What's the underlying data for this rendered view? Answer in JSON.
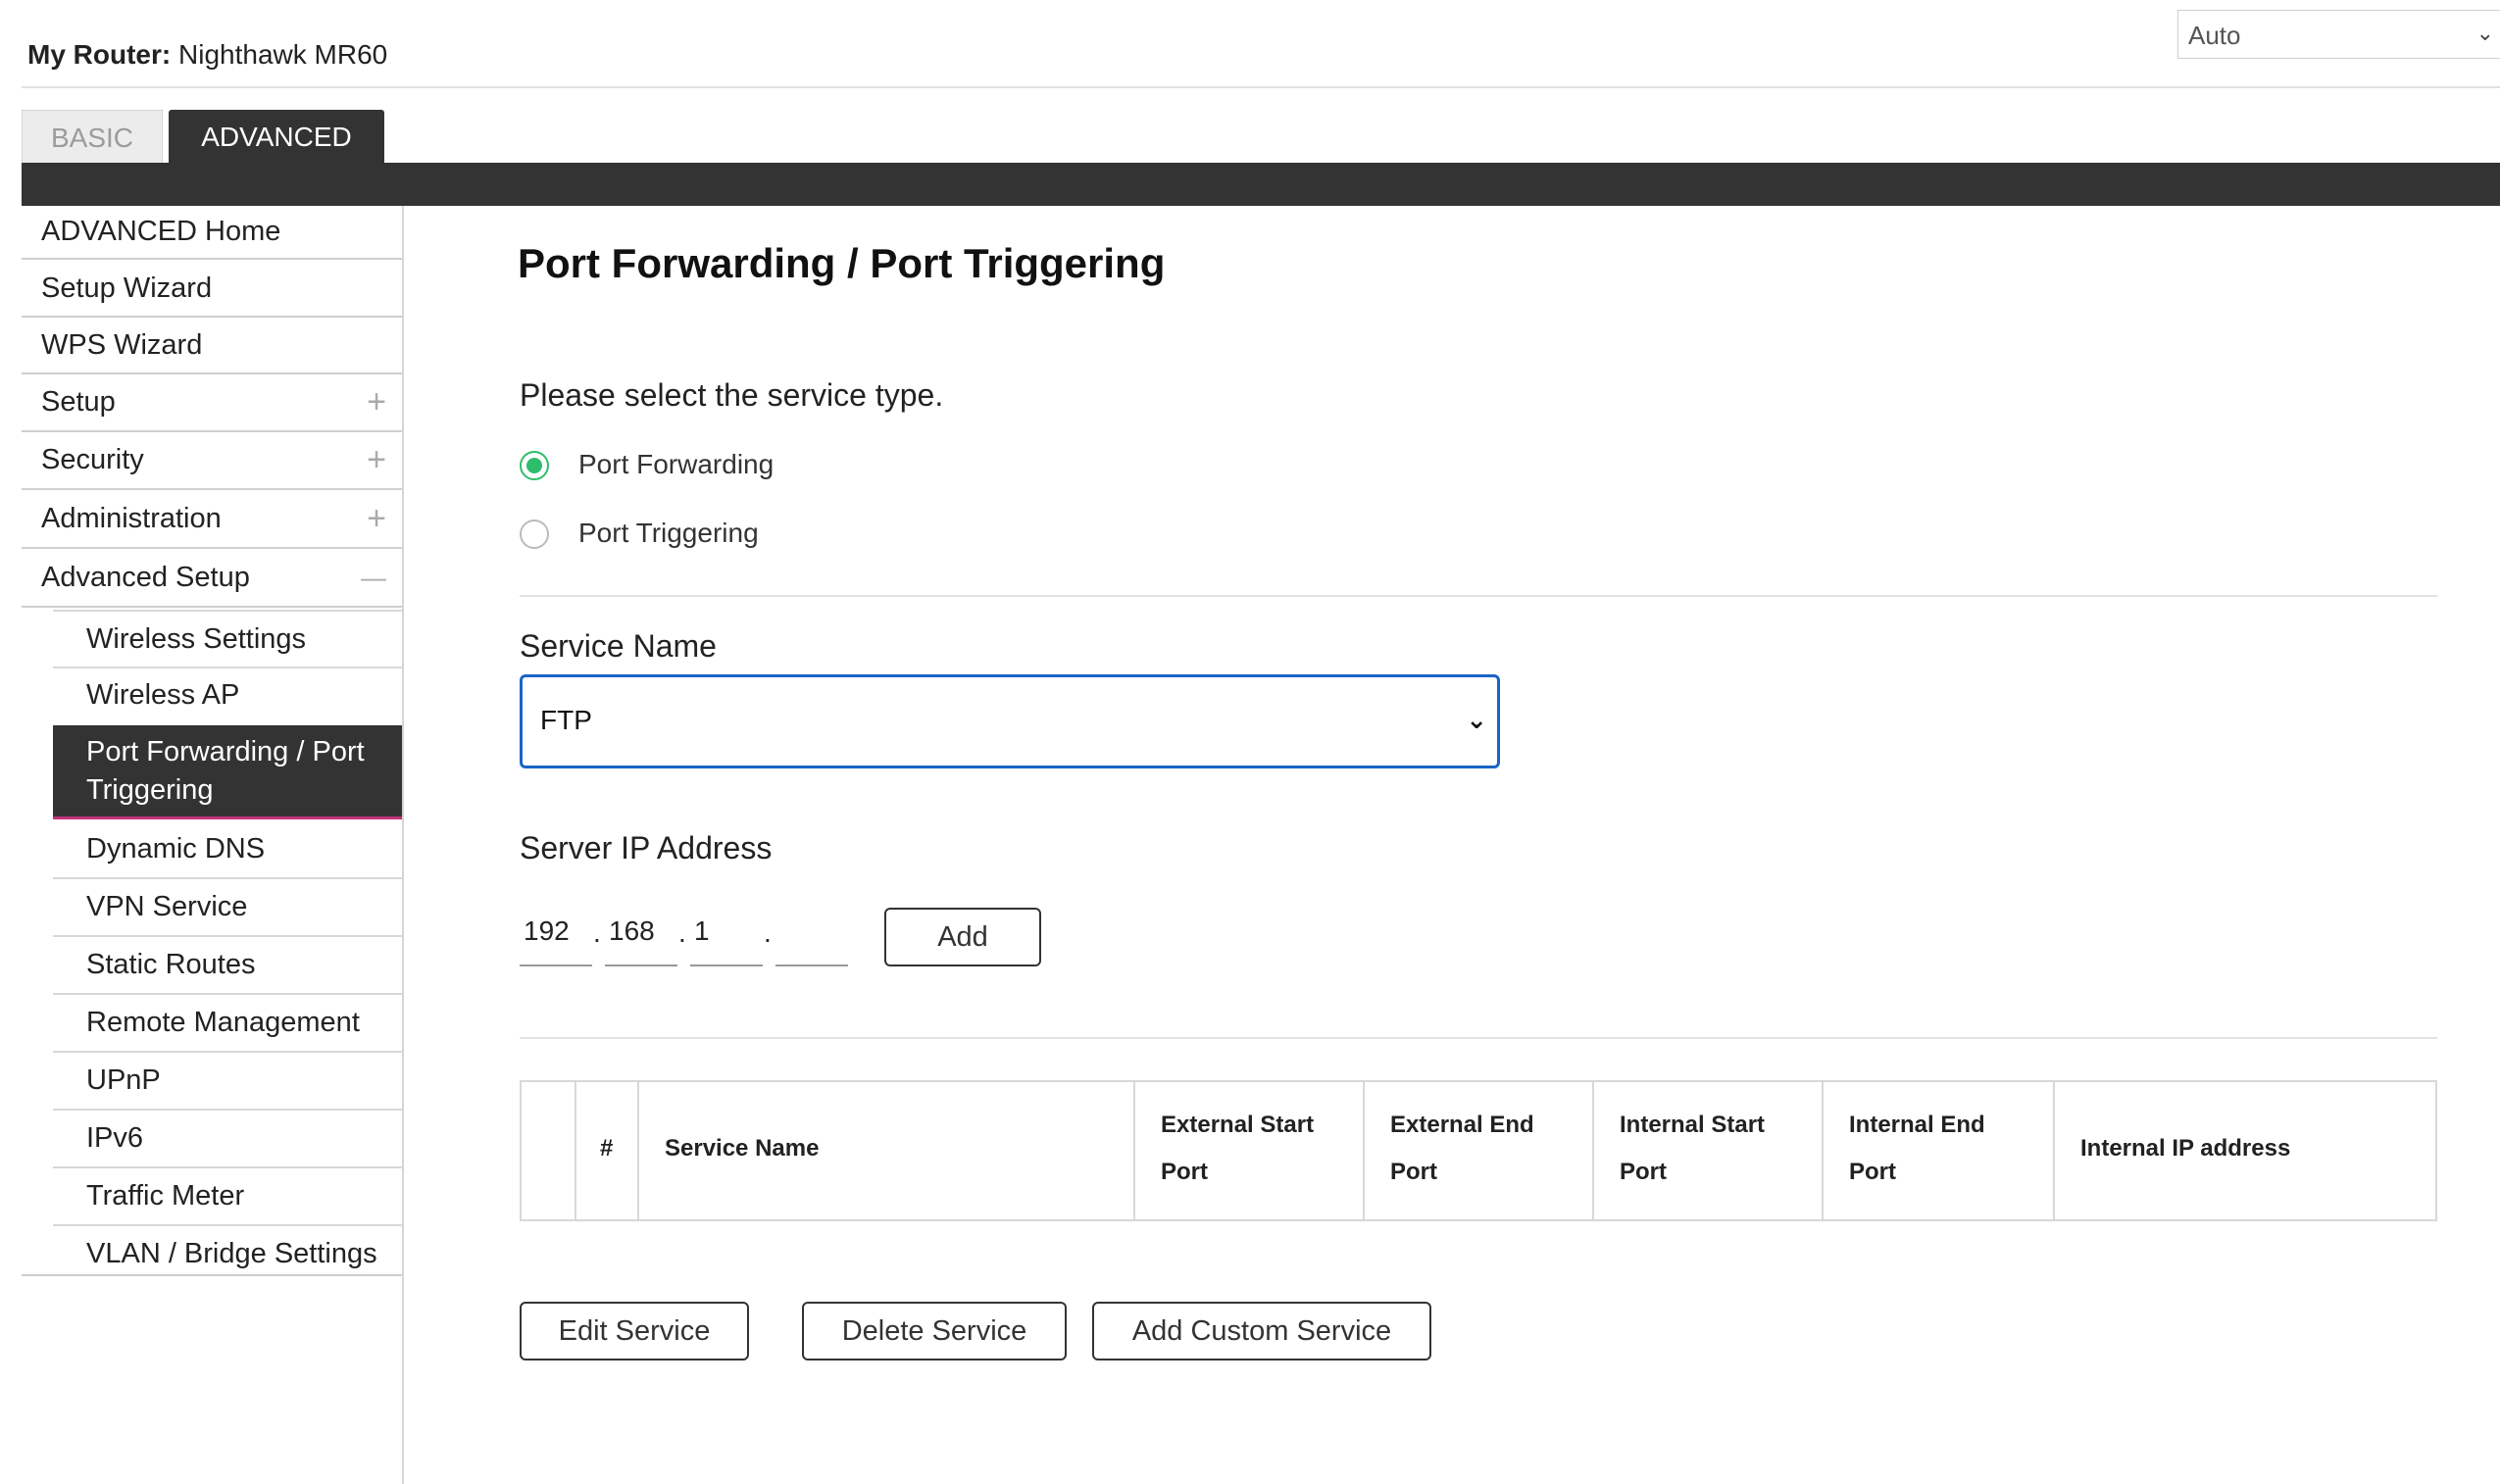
{
  "header": {
    "router_prefix": "My Router:",
    "router_name": "Nighthawk MR60",
    "language": "Auto",
    "language_icon": "chevron-down-icon"
  },
  "tabs": [
    {
      "label": "BASIC",
      "active": false
    },
    {
      "label": "ADVANCED",
      "active": true
    }
  ],
  "sidebar": {
    "items": [
      {
        "label": "ADVANCED Home",
        "expander": ""
      },
      {
        "label": "Setup Wizard",
        "expander": ""
      },
      {
        "label": "WPS Wizard",
        "expander": ""
      },
      {
        "label": "Setup",
        "expander": "+"
      },
      {
        "label": "Security",
        "expander": "+"
      },
      {
        "label": "Administration",
        "expander": "+"
      },
      {
        "label": "Advanced Setup",
        "expander": "—"
      }
    ],
    "sub_items": [
      {
        "label": "Wireless Settings"
      },
      {
        "label": "Wireless AP"
      },
      {
        "label": "Port Forwarding / Port Triggering",
        "active": true
      },
      {
        "label": "Dynamic DNS"
      },
      {
        "label": "VPN Service"
      },
      {
        "label": "Static Routes"
      },
      {
        "label": "Remote Management"
      },
      {
        "label": "UPnP"
      },
      {
        "label": "IPv6"
      },
      {
        "label": "Traffic Meter"
      },
      {
        "label": "VLAN / Bridge Settings"
      }
    ]
  },
  "main": {
    "title": "Port Forwarding / Port Triggering",
    "service_type_prompt": "Please select the service type.",
    "service_types": [
      {
        "label": "Port Forwarding",
        "selected": true
      },
      {
        "label": "Port Triggering",
        "selected": false
      }
    ],
    "service_name_label": "Service Name",
    "service_name_value": "FTP",
    "server_ip_label": "Server IP Address",
    "ip_octets": [
      "192",
      "168",
      "1",
      ""
    ],
    "ip_separator": ".",
    "add_button": "Add",
    "table_headers": [
      {
        "l1": "",
        "l2": ""
      },
      {
        "l1": "#",
        "l2": ""
      },
      {
        "l1": "Service Name",
        "l2": ""
      },
      {
        "l1": "External Start",
        "l2": "Port"
      },
      {
        "l1": "External End",
        "l2": "Port"
      },
      {
        "l1": "Internal Start",
        "l2": "Port"
      },
      {
        "l1": "Internal End",
        "l2": "Port"
      },
      {
        "l1": "Internal IP address",
        "l2": ""
      }
    ],
    "buttons": {
      "edit": "Edit Service",
      "delete": "Delete Service",
      "add_custom": "Add Custom Service"
    }
  },
  "colors": {
    "accent_green": "#2ebd6b",
    "focus_blue": "#1a64c8",
    "dark_bar": "#333333",
    "active_underline": "#c3327a"
  }
}
